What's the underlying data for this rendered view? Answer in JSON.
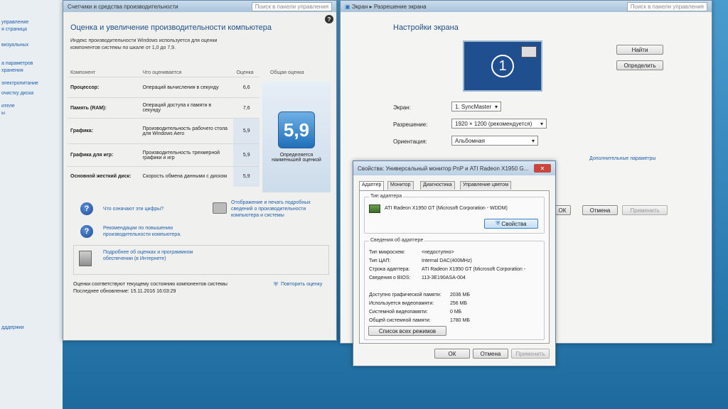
{
  "left_sidebar": {
    "items": [
      "управление",
      "я страница",
      "визуальных",
      "а параметров",
      "хранения",
      "электропитание",
      "очистку диска",
      "ителе",
      "ы",
      "дддержки"
    ]
  },
  "perf_window": {
    "breadcrumb": "Счетчики и средства производительности",
    "search_placeholder": "Поиск в панели управления",
    "title": "Оценка и увеличение производительности компьютера",
    "intro": "Индекс производительности Windows используется для оценки компонентов системы по шкале от 1,0 до 7,9.",
    "headers": {
      "component": "Компонент",
      "what": "Что оценивается",
      "score": "Оценка",
      "overall": "Общая оценка"
    },
    "rows": [
      {
        "component": "Процессор:",
        "what": "Операций вычисления в секунду",
        "score": "6,6"
      },
      {
        "component": "Память (RAM):",
        "what": "Операций доступа к памяти в секунду",
        "score": "7,6"
      },
      {
        "component": "Графика:",
        "what": "Производительность рабочего стола для Windows Aero",
        "score": "5,9"
      },
      {
        "component": "Графика для игр:",
        "what": "Производительность трехмерной графики и игр",
        "score": "5,9"
      },
      {
        "component": "Основной жесткий диск:",
        "what": "Скорость обмена данными с диском",
        "score": "5,9"
      }
    ],
    "overall_score": "5,9",
    "overall_caption": "Определяется наименьшей оценкой",
    "link1": "Что означают эти цифры?",
    "link2": "Отображение и печать подробных сведений о производительности компьютера и системы",
    "link3": "Рекомендации по повышению производительности компьютера.",
    "link4": "Подробнее об оценках и программном обеспечении (в Интернете)",
    "status": "Оценки соответствуют текущему состоянию компонентов системы",
    "last_update": "Последнее обновление: 15.11.2016 16:03:29",
    "rerun": "Повторить оценку"
  },
  "screen_window": {
    "breadcrumb_1": "Экран",
    "breadcrumb_2": "Разрешение экрана",
    "search_placeholder": "Поиск в панели управления",
    "title": "Настройки экрана",
    "monitor_number": "1",
    "find_button": "Найти",
    "identify_button": "Определить",
    "display_label": "Экран:",
    "display_value": "1. SyncMaster",
    "resolution_label": "Разрешение:",
    "resolution_value": "1920 × 1200 (рекомендуется)",
    "orientation_label": "Ориентация:",
    "orientation_value": "Альбомная",
    "advanced_link": "Дополнительные параметры",
    "ok": "ОК",
    "cancel": "Отмена",
    "apply": "Применить"
  },
  "dialog": {
    "title": "Свойства: Универсальный монитор PnP и ATI Radeon X1950 G...",
    "tabs": [
      "Адаптер",
      "Монитор",
      "Диагностика",
      "Управление цветом"
    ],
    "adapter_type_legend": "Тип адаптера",
    "adapter_name": "ATI Radeon X1950 GT (Microsoft Corporation - WDDM)",
    "properties_button": "Свойства",
    "info_legend": "Сведения об адаптере",
    "info": [
      {
        "k": "Тип микросхем:",
        "v": "<недоступно>"
      },
      {
        "k": "Тип ЦАП:",
        "v": "Internal DAC(400MHz)"
      },
      {
        "k": "Строка адаптера:",
        "v": "ATI Radeon X1950 GT (Microsoft Corporation -"
      },
      {
        "k": "Сведения о BIOS:",
        "v": "113-3E190ASA-004"
      }
    ],
    "memory": [
      {
        "k": "Доступно графической памяти:",
        "v": "2036 МБ"
      },
      {
        "k": "Используется видеопамяти:",
        "v": "256 МБ"
      },
      {
        "k": "Системной видеопамяти:",
        "v": "0 МБ"
      },
      {
        "k": "Общей системной памяти:",
        "v": "1780 МБ"
      }
    ],
    "list_modes_button": "Список всех режимов",
    "ok": "ОК",
    "cancel": "Отмена",
    "apply": "Применить"
  }
}
